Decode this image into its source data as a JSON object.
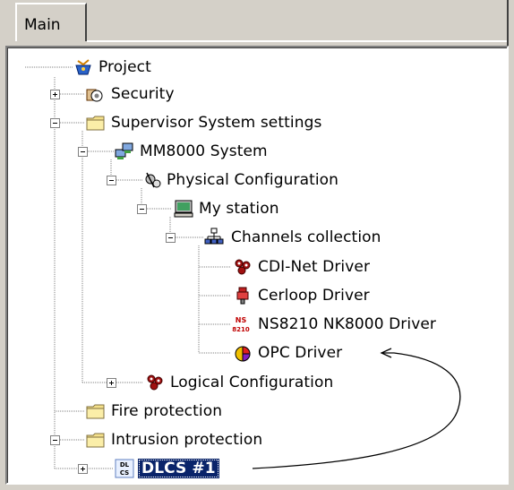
{
  "tabs": [
    {
      "label": "Main"
    }
  ],
  "tree": {
    "project": {
      "label": "Project",
      "icon": "project-icon"
    },
    "security": {
      "label": "Security",
      "icon": "security-icon",
      "expander": "+"
    },
    "supervisor": {
      "label": "Supervisor System settings",
      "icon": "folder-icon",
      "expander": "-"
    },
    "mm8000": {
      "label": "MM8000 System",
      "icon": "computers-icon",
      "expander": "-"
    },
    "physical": {
      "label": "Physical Configuration",
      "icon": "gears-icon",
      "expander": "-"
    },
    "station": {
      "label": "My station",
      "icon": "station-icon",
      "expander": "-"
    },
    "channels": {
      "label": "Channels collection",
      "icon": "network-icon",
      "expander": "-"
    },
    "cdinet": {
      "label": "CDI-Net Driver",
      "icon": "cdi-driver-icon"
    },
    "cerloop": {
      "label": "Cerloop Driver",
      "icon": "cerloop-driver-icon"
    },
    "ns8210": {
      "label": "NS8210 NK8000 Driver",
      "icon": "ns8210-driver-icon",
      "icon_text": [
        "NS",
        "8210"
      ]
    },
    "opc": {
      "label": "OPC Driver",
      "icon": "opc-driver-icon"
    },
    "logical": {
      "label": "Logical Configuration",
      "icon": "logical-config-icon",
      "expander": "+"
    },
    "fire": {
      "label": "Fire protection",
      "icon": "folder-icon"
    },
    "intrusion": {
      "label": "Intrusion protection",
      "icon": "folder-icon",
      "expander": "-"
    },
    "dlcs": {
      "label": "DLCS #1",
      "icon": "dlcs-icon",
      "icon_text": [
        "DL",
        "CS"
      ],
      "expander": "+",
      "selected": true
    }
  },
  "colors": {
    "selection": "#0a246a",
    "folder": "#f4e08a",
    "annotation_line": "#000000"
  }
}
